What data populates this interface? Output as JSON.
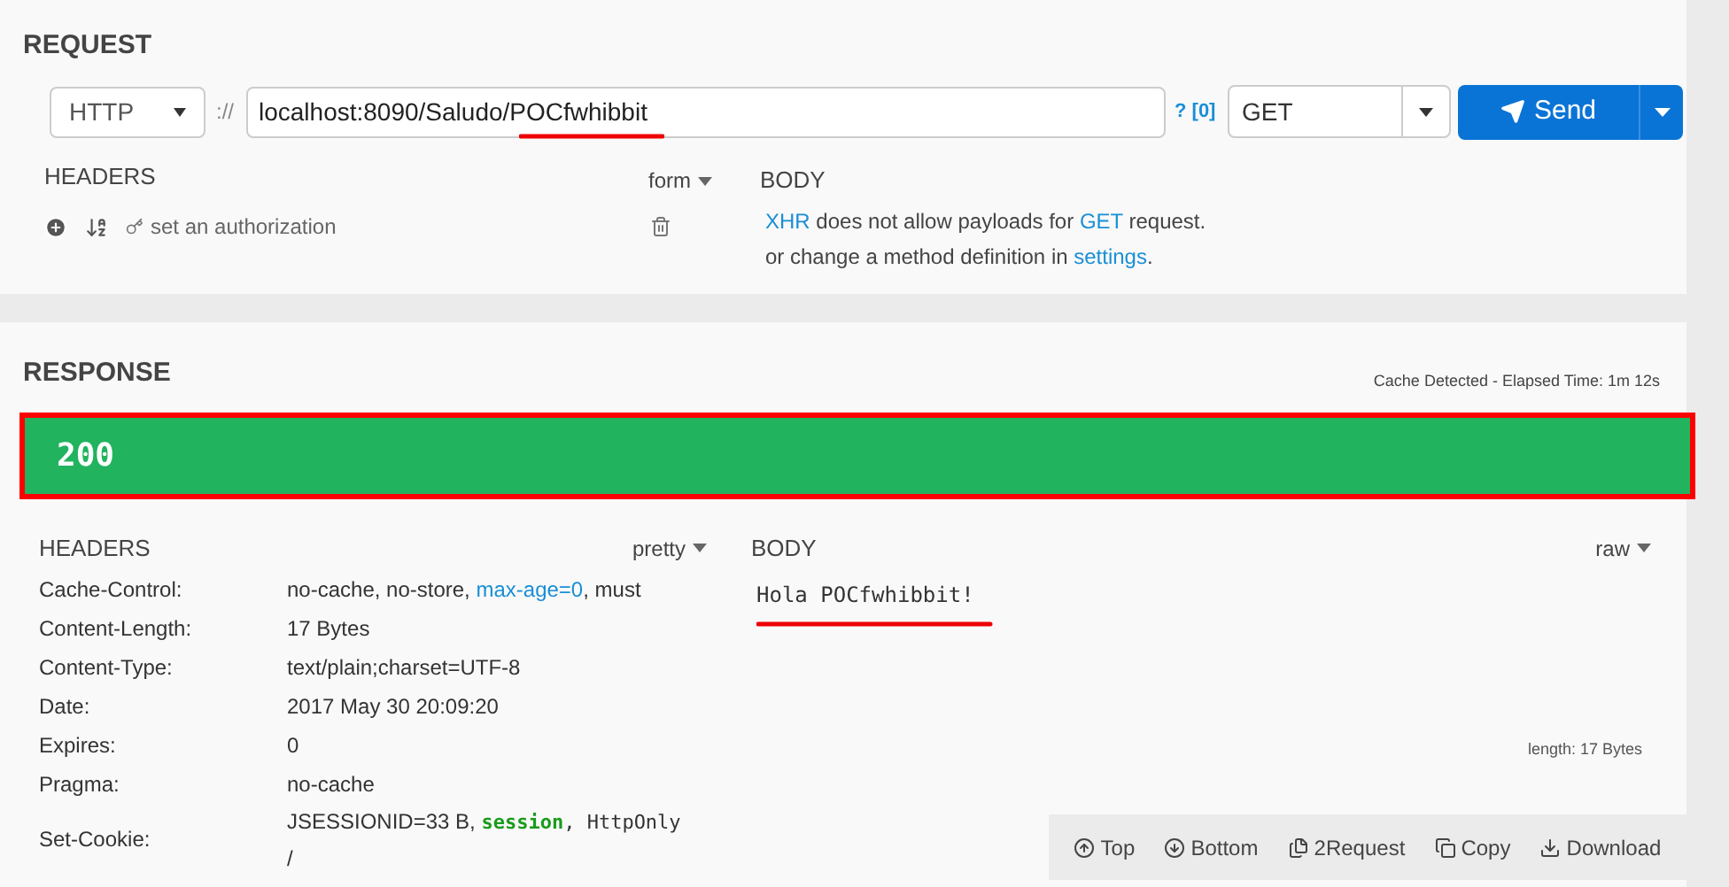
{
  "request": {
    "title": "REQUEST",
    "scheme": "HTTP",
    "separator": "://",
    "url": "localhost:8090/Saludo/POCfwhibbit",
    "help": "? [0]",
    "method": "GET",
    "send": "Send",
    "headers": {
      "title": "HEADERS",
      "mode": "form",
      "authorization": "set an authorization"
    },
    "body": {
      "title": "BODY",
      "lines": [
        [
          {
            "text": "XHR",
            "kind": "link"
          },
          {
            "text": " does not allow payloads for ",
            "kind": "plain"
          },
          {
            "text": "GET",
            "kind": "link"
          },
          {
            "text": " request.",
            "kind": "plain"
          }
        ],
        [
          {
            "text": "or change a method definition in ",
            "kind": "plain"
          },
          {
            "text": "settings",
            "kind": "link"
          },
          {
            "text": ".",
            "kind": "plain"
          }
        ]
      ]
    }
  },
  "response": {
    "title": "RESPONSE",
    "timing": "Cache Detected - Elapsed Time: 1m 12s",
    "status": "200",
    "headers": {
      "title": "HEADERS",
      "mode": "pretty",
      "rows": [
        {
          "name": "Cache-Control:",
          "value": [
            {
              "text": "no-cache, no-store, ",
              "kind": "plain"
            },
            {
              "text": "max-age=0",
              "kind": "link"
            },
            {
              "text": ", must",
              "kind": "plain"
            }
          ]
        },
        {
          "name": "Content-Length:",
          "value": [
            {
              "text": "17 Bytes",
              "kind": "plain"
            }
          ]
        },
        {
          "name": "Content-Type:",
          "value": [
            {
              "text": "text/plain;charset=UTF-8",
              "kind": "plain"
            }
          ]
        },
        {
          "name": "Date:",
          "value": [
            {
              "text": "2017 May 30 20:09:20",
              "kind": "plain"
            }
          ]
        },
        {
          "name": "Expires:",
          "value": [
            {
              "text": "0",
              "kind": "plain"
            }
          ]
        },
        {
          "name": "Pragma:",
          "value": [
            {
              "text": "no-cache",
              "kind": "plain"
            }
          ]
        },
        {
          "name": "Set-Cookie:",
          "value": [
            {
              "text": "JSESSIONID=33 B, ",
              "kind": "plain"
            },
            {
              "text": "session",
              "kind": "code-green"
            },
            {
              "text": ", HttpOnly",
              "kind": "code"
            }
          ],
          "second_line": "/"
        }
      ]
    },
    "body": {
      "title": "BODY",
      "mode": "raw",
      "content": "Hola POCfwhibbit!",
      "length": "length: 17 Bytes"
    },
    "toolbar": [
      {
        "label": "Top"
      },
      {
        "label": "Bottom"
      },
      {
        "label": "2Request"
      },
      {
        "label": "Copy"
      },
      {
        "label": "Download"
      }
    ]
  }
}
